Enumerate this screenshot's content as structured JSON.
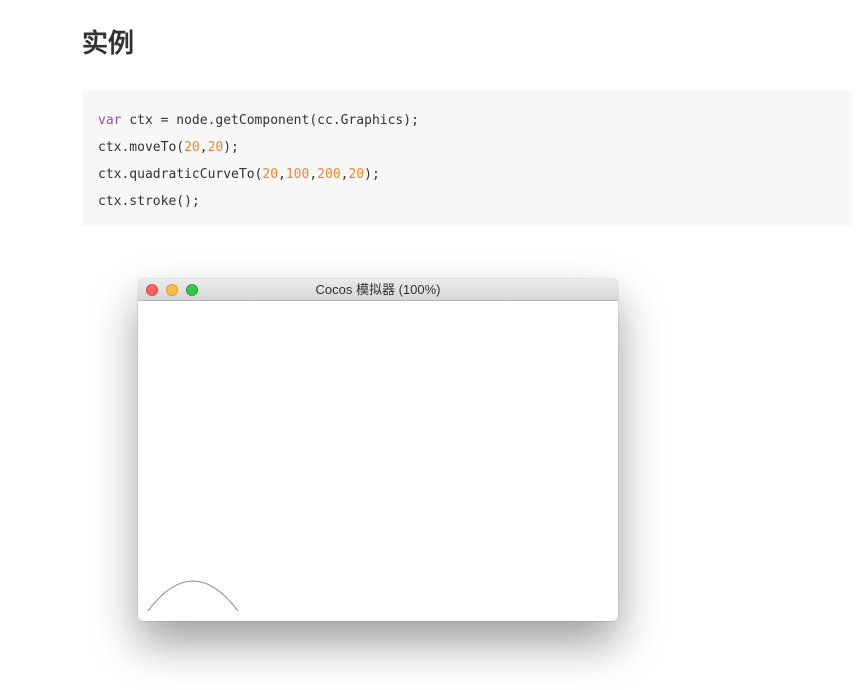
{
  "page": {
    "title": "实例"
  },
  "code": {
    "line1": {
      "kw": "var",
      "rest": " ctx = node.getComponent(cc.Graphics);"
    },
    "line2": {
      "a": "ctx.moveTo(",
      "n1": "20",
      "c1": ",",
      "n2": "20",
      "b": ");"
    },
    "line3": {
      "a": "ctx.quadraticCurveTo(",
      "n1": "20",
      "c1": ",",
      "n2": "100",
      "c2": ",",
      "n3": "200",
      "c3": ",",
      "n4": "20",
      "b": ");"
    },
    "line4": {
      "a": "ctx.stroke();"
    }
  },
  "simulator": {
    "title": "Cocos 模拟器 (100%)"
  },
  "colors": {
    "keyword": "#a24ba6",
    "number": "#e8882d",
    "code_background": "#f7f7f7",
    "curve_stroke": "#8a8a8a"
  }
}
